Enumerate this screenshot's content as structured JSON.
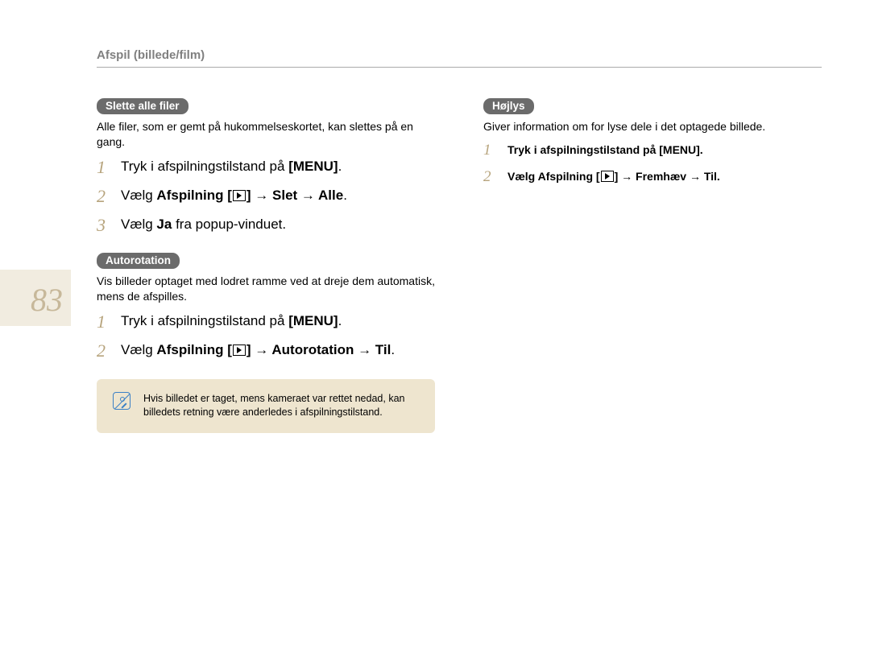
{
  "breadcrumb": "Afspil (billede/film)",
  "page_number": "83",
  "left": {
    "section1": {
      "title": "Slette alle filer",
      "desc": "Alle filer, som er gemt på hukommelseskortet, kan slettes på en gang.",
      "steps": [
        {
          "pre": "Tryk i afspilningstilstand på ",
          "bold": "[MENU]",
          "post": "."
        },
        {
          "pre": "Vælg ",
          "bold1": "Afspilning [",
          "icon": true,
          "bold2": "] → Slet → Alle",
          "post": ".",
          "allbold": true
        },
        {
          "pre": "Vælg ",
          "bold": "Ja",
          "post": " fra popup-vinduet."
        }
      ]
    },
    "section2": {
      "title": "Autorotation",
      "desc": "Vis billeder optaget med lodret ramme ved at dreje dem automatisk, mens de afspilles.",
      "steps": [
        {
          "pre": "Tryk i afspilningstilstand på ",
          "bold": "[MENU]",
          "post": "."
        },
        {
          "pre": "Vælg ",
          "bold1": "Afspilning [",
          "icon": true,
          "bold2": "] → Autorotation → Til",
          "post": ".",
          "allbold": true
        }
      ]
    },
    "note": "Hvis billedet er taget, mens kameraet var rettet nedad, kan billedets retning være anderledes i afspilningstilstand."
  },
  "right": {
    "section1": {
      "title": "Højlys",
      "desc": "Giver information om for lyse dele i det optagede billede.",
      "steps": [
        {
          "text": "Tryk i afspilningstilstand på [MENU]."
        },
        {
          "pre": "Vælg Afspilning [",
          "icon": true,
          "post": "] → Fremhæv → Til."
        }
      ]
    }
  }
}
